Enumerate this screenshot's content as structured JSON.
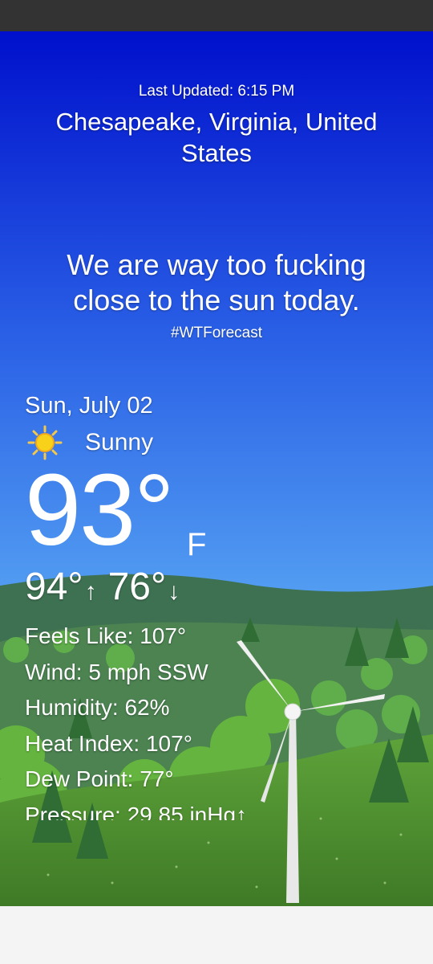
{
  "header": {
    "last_updated": "Last Updated: 6:15 PM",
    "location": "Chesapeake, Virginia, United States"
  },
  "forecast": {
    "tagline": "We are way too fucking close to the sun today.",
    "hashtag": "#WTForecast"
  },
  "current": {
    "date": "Sun, July 02",
    "condition": "Sunny",
    "condition_icon": "sun-icon",
    "temperature": "93°",
    "unit": "F",
    "high": "94°",
    "low": "76°",
    "high_arrow": "↑",
    "low_arrow": "↓"
  },
  "details": [
    {
      "label": "Feels Like:",
      "value": "107°"
    },
    {
      "label": "Wind:",
      "value": "5 mph SSW"
    },
    {
      "label": "Humidity:",
      "value": "62%"
    },
    {
      "label": "Heat Index:",
      "value": "107°"
    },
    {
      "label": "Dew Point:",
      "value": "77°"
    },
    {
      "label": "Pressure:",
      "value": "29.85 inHg↑"
    }
  ],
  "colors": {
    "sky_top": "#0010cc",
    "sky_bottom": "#5aa9f4",
    "grass": "#4f8f2c",
    "text": "#ffffff",
    "status_bar": "#333333"
  }
}
